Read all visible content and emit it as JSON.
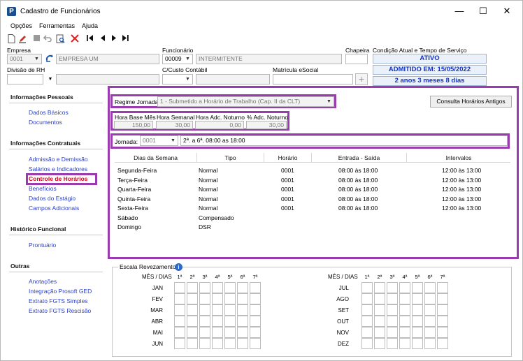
{
  "window": {
    "title": "Cadastro de Funcionários",
    "minimize": "—",
    "maximize": "☐",
    "close": "✕"
  },
  "menu": [
    "Opções",
    "Ferramentas",
    "Ajuda"
  ],
  "toolbar_icons": [
    "new-document-icon",
    "edit-icon",
    "stop-icon",
    "undo-icon",
    "print-preview-icon",
    "delete-icon",
    "first-record-icon",
    "previous-record-icon",
    "next-record-icon",
    "last-record-icon"
  ],
  "header": {
    "empresa_label": "Empresa",
    "empresa_code": "0001",
    "empresa_name": "EMPRESA UM",
    "funcionario_label": "Funcionário",
    "funcionario_code": "00009",
    "funcionario_name": "INTERMITENTE",
    "chapeira_label": "Chapeira",
    "chapeira_value": "",
    "condicao_label": "Condição Atual e Tempo de Serviço",
    "status": "ATIVO",
    "admitido": "ADMITIDO EM: 15/05/2022",
    "tempo_servico": "2 anos 3 meses 8 dias",
    "divisao_label": "Divisão de RH",
    "divisao_value": "",
    "custo_label": "C/Custo Contábil",
    "custo_value": "",
    "matricula_label": "Matrícula eSocial",
    "matricula_value": ""
  },
  "sidebar": {
    "sections": [
      {
        "title": "Informações Pessoais",
        "items": [
          "Dados Básicos",
          "Documentos"
        ]
      },
      {
        "title": "Informações Contratuais",
        "items": [
          "Admissão e Demissão",
          "Salários e Indicadores",
          "Controle de Horários",
          "Benefícios",
          "Dados do Estágio",
          "Campos Adicionais"
        ]
      },
      {
        "title": "Histórico Funcional",
        "items": [
          "Prontuário"
        ]
      },
      {
        "title": "Outras",
        "items": [
          "Anotações",
          "Integração Prosoft GED",
          "Extrato FGTS Simples",
          "Extrato FGTS Rescisão"
        ]
      }
    ],
    "active_item": "Controle de Horários"
  },
  "regime": {
    "label": "Regime Jornada",
    "value": "1 - Submetido a Horário de Trabalho (Cap. II da CLT)"
  },
  "consulta_button": "Consulta Horários Antigos",
  "hours": {
    "headers": [
      "Hora Base Mês",
      "Hora Semanal",
      "Hora Adc. Noturno",
      "% Adc. Noturno"
    ],
    "values": [
      "150,00",
      "30,00",
      "0,00",
      "30,00"
    ]
  },
  "jornada": {
    "label": "Jornada:",
    "code": "0001",
    "description": "2ª. a 6ª. 08:00 as 18:00"
  },
  "schedule": {
    "columns": [
      "Dias da Semana",
      "Tipo",
      "Horário",
      "Entrada - Saída",
      "Intervalos"
    ],
    "rows": [
      [
        "Segunda-Feira",
        "Normal",
        "0001",
        "08:00 às 18:00",
        "12:00 às 13:00"
      ],
      [
        "Terça-Feira",
        "Normal",
        "0001",
        "08:00 às 18:00",
        "12:00 às 13:00"
      ],
      [
        "Quarta-Feira",
        "Normal",
        "0001",
        "08:00 às 18:00",
        "12:00 às 13:00"
      ],
      [
        "Quinta-Feira",
        "Normal",
        "0001",
        "08:00 às 18:00",
        "12:00 às 13:00"
      ],
      [
        "Sexta-Feira",
        "Normal",
        "0001",
        "08:00 às 18:00",
        "12:00 às 13:00"
      ],
      [
        "Sábado",
        "Compensado",
        "",
        "",
        ""
      ],
      [
        "Domingo",
        "DSR",
        "",
        "",
        ""
      ]
    ]
  },
  "escala": {
    "title": "Escala Revezamento",
    "mes_dias_label": "MÊS / DIAS",
    "days": [
      "1ª",
      "2ª",
      "3ª",
      "4ª",
      "5ª",
      "6ª",
      "7ª"
    ],
    "months_left": [
      "JAN",
      "FEV",
      "MAR",
      "ABR",
      "MAI",
      "JUN"
    ],
    "months_right": [
      "JUL",
      "AGO",
      "SET",
      "OUT",
      "NOV",
      "DEZ"
    ]
  }
}
